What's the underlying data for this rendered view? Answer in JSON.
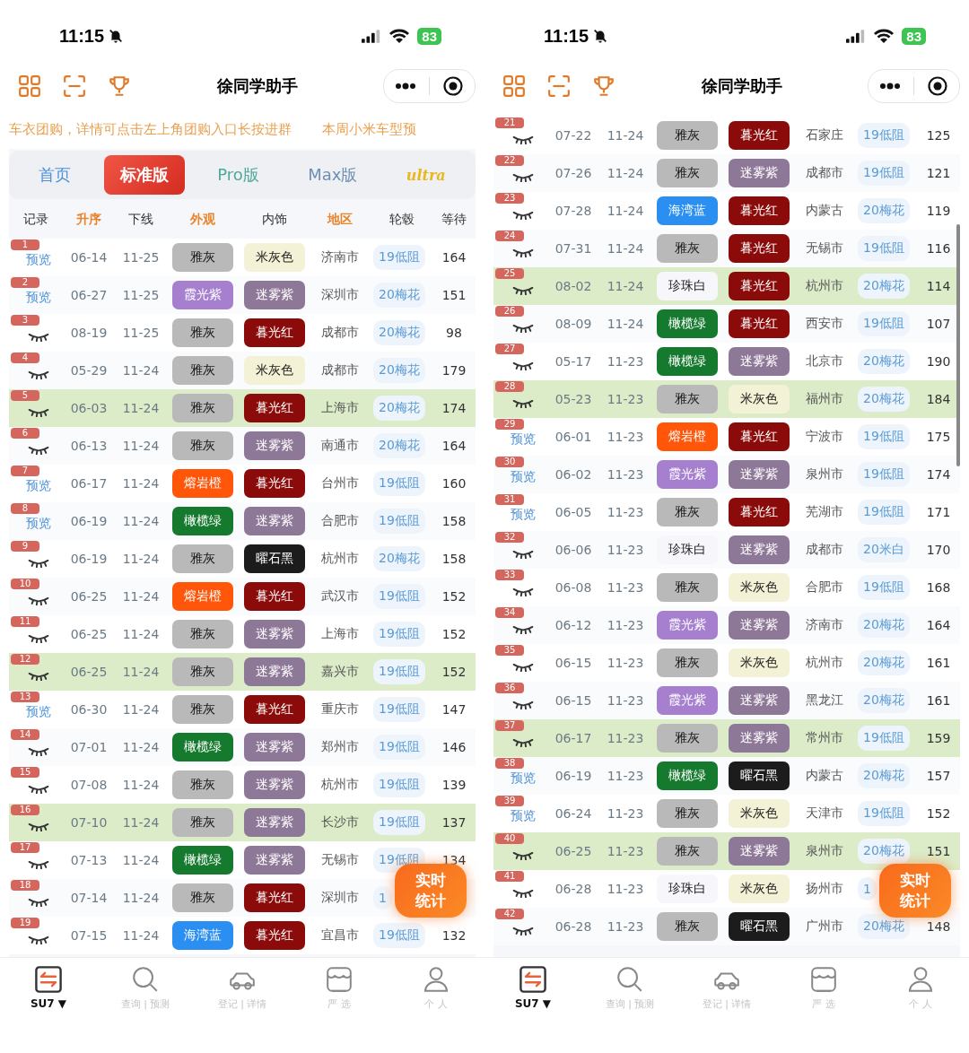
{
  "panels": [
    {
      "status_bar": {
        "time": "11:15",
        "battery": "83"
      },
      "header": {
        "title": "徐同学助手"
      },
      "marquee": [
        "车衣团购，详情可点击左上角团购入口长按进群",
        "本周小米车型预"
      ],
      "tabs": [
        {
          "label": "首页",
          "selected": false,
          "kind": "text",
          "color": "#4a90d9"
        },
        {
          "label": "标准版",
          "selected": true,
          "kind": "text"
        },
        {
          "label": "Pro版",
          "selected": false,
          "kind": "text",
          "color": "#4fa89a"
        },
        {
          "label": "Max版",
          "selected": false,
          "kind": "text",
          "color": "#6f8fb5"
        },
        {
          "label": "ultra",
          "selected": false,
          "kind": "logo",
          "color": "#e8b820"
        }
      ],
      "table": {
        "columns": [
          {
            "label": "记录",
            "highlighted": false
          },
          {
            "label": "升序",
            "highlighted": true
          },
          {
            "label": "下线",
            "highlighted": false
          },
          {
            "label": "外观",
            "highlighted": true
          },
          {
            "label": "内饰",
            "highlighted": false
          },
          {
            "label": "地区",
            "highlighted": true
          },
          {
            "label": "轮毂",
            "highlighted": false
          },
          {
            "label": "等待",
            "highlighted": false
          }
        ],
        "rows": [
          {
            "no": "1",
            "record": {
              "kind": "link",
              "text": "预览"
            },
            "order": "06-14",
            "offline": "11-25",
            "exterior": {
              "text": "雅灰",
              "color": "#b9b9b9"
            },
            "interior": {
              "text": "米灰色",
              "color": "#f3f1d6"
            },
            "region": "济南市",
            "wheel": "19低阻",
            "wait": "164",
            "selected": false
          },
          {
            "no": "2",
            "record": {
              "kind": "link",
              "text": "预览"
            },
            "order": "06-27",
            "offline": "11-25",
            "exterior": {
              "text": "霞光紫",
              "color": "#a67fcf"
            },
            "interior": {
              "text": "迷雾紫",
              "color": "#8e7898"
            },
            "region": "深圳市",
            "wheel": "20梅花",
            "wait": "151",
            "selected": false
          },
          {
            "no": "3",
            "record": {
              "kind": "eye"
            },
            "order": "08-19",
            "offline": "11-25",
            "exterior": {
              "text": "雅灰",
              "color": "#b9b9b9"
            },
            "interior": {
              "text": "暮光红",
              "color": "#8b0a0a"
            },
            "region": "成都市",
            "wheel": "20梅花",
            "wait": "98",
            "selected": false
          },
          {
            "no": "4",
            "record": {
              "kind": "eye"
            },
            "order": "05-29",
            "offline": "11-24",
            "exterior": {
              "text": "雅灰",
              "color": "#b9b9b9"
            },
            "interior": {
              "text": "米灰色",
              "color": "#f3f1d6"
            },
            "region": "成都市",
            "wheel": "20梅花",
            "wait": "179",
            "selected": false
          },
          {
            "no": "5",
            "record": {
              "kind": "eye"
            },
            "order": "06-03",
            "offline": "11-24",
            "exterior": {
              "text": "雅灰",
              "color": "#b9b9b9"
            },
            "interior": {
              "text": "暮光红",
              "color": "#8b0a0a"
            },
            "region": "上海市",
            "wheel": "20梅花",
            "wait": "174",
            "selected": true
          },
          {
            "no": "6",
            "record": {
              "kind": "eye"
            },
            "order": "06-13",
            "offline": "11-24",
            "exterior": {
              "text": "雅灰",
              "color": "#b9b9b9"
            },
            "interior": {
              "text": "迷雾紫",
              "color": "#8e7898"
            },
            "region": "南通市",
            "wheel": "20梅花",
            "wait": "164",
            "selected": false
          },
          {
            "no": "7",
            "record": {
              "kind": "link",
              "text": "预览"
            },
            "order": "06-17",
            "offline": "11-24",
            "exterior": {
              "text": "熔岩橙",
              "color": "#ff560a"
            },
            "interior": {
              "text": "暮光红",
              "color": "#8b0a0a"
            },
            "region": "台州市",
            "wheel": "19低阻",
            "wait": "160",
            "selected": false
          },
          {
            "no": "8",
            "record": {
              "kind": "link",
              "text": "预览"
            },
            "order": "06-19",
            "offline": "11-24",
            "exterior": {
              "text": "橄榄绿",
              "color": "#157a2e"
            },
            "interior": {
              "text": "迷雾紫",
              "color": "#8e7898"
            },
            "region": "合肥市",
            "wheel": "19低阻",
            "wait": "158",
            "selected": false
          },
          {
            "no": "9",
            "record": {
              "kind": "eye"
            },
            "order": "06-19",
            "offline": "11-24",
            "exterior": {
              "text": "雅灰",
              "color": "#b9b9b9"
            },
            "interior": {
              "text": "曜石黑",
              "color": "#1c1c1c"
            },
            "region": "杭州市",
            "wheel": "20梅花",
            "wait": "158",
            "selected": false
          },
          {
            "no": "10",
            "record": {
              "kind": "eye"
            },
            "order": "06-25",
            "offline": "11-24",
            "exterior": {
              "text": "熔岩橙",
              "color": "#ff560a"
            },
            "interior": {
              "text": "暮光红",
              "color": "#8b0a0a"
            },
            "region": "武汉市",
            "wheel": "19低阻",
            "wait": "152",
            "selected": false
          },
          {
            "no": "11",
            "record": {
              "kind": "eye"
            },
            "order": "06-25",
            "offline": "11-24",
            "exterior": {
              "text": "雅灰",
              "color": "#b9b9b9"
            },
            "interior": {
              "text": "迷雾紫",
              "color": "#8e7898"
            },
            "region": "上海市",
            "wheel": "19低阻",
            "wait": "152",
            "selected": false
          },
          {
            "no": "12",
            "record": {
              "kind": "eye"
            },
            "order": "06-25",
            "offline": "11-24",
            "exterior": {
              "text": "雅灰",
              "color": "#b9b9b9"
            },
            "interior": {
              "text": "迷雾紫",
              "color": "#8e7898"
            },
            "region": "嘉兴市",
            "wheel": "19低阻",
            "wait": "152",
            "selected": true
          },
          {
            "no": "13",
            "record": {
              "kind": "link",
              "text": "预览"
            },
            "order": "06-30",
            "offline": "11-24",
            "exterior": {
              "text": "雅灰",
              "color": "#b9b9b9"
            },
            "interior": {
              "text": "暮光红",
              "color": "#8b0a0a"
            },
            "region": "重庆市",
            "wheel": "19低阻",
            "wait": "147",
            "selected": false
          },
          {
            "no": "14",
            "record": {
              "kind": "eye"
            },
            "order": "07-01",
            "offline": "11-24",
            "exterior": {
              "text": "橄榄绿",
              "color": "#157a2e"
            },
            "interior": {
              "text": "迷雾紫",
              "color": "#8e7898"
            },
            "region": "郑州市",
            "wheel": "19低阻",
            "wait": "146",
            "selected": false
          },
          {
            "no": "15",
            "record": {
              "kind": "eye"
            },
            "order": "07-08",
            "offline": "11-24",
            "exterior": {
              "text": "雅灰",
              "color": "#b9b9b9"
            },
            "interior": {
              "text": "迷雾紫",
              "color": "#8e7898"
            },
            "region": "杭州市",
            "wheel": "19低阻",
            "wait": "139",
            "selected": false
          },
          {
            "no": "16",
            "record": {
              "kind": "eye"
            },
            "order": "07-10",
            "offline": "11-24",
            "exterior": {
              "text": "雅灰",
              "color": "#b9b9b9"
            },
            "interior": {
              "text": "迷雾紫",
              "color": "#8e7898"
            },
            "region": "长沙市",
            "wheel": "19低阻",
            "wait": "137",
            "selected": true
          },
          {
            "no": "17",
            "record": {
              "kind": "eye"
            },
            "order": "07-13",
            "offline": "11-24",
            "exterior": {
              "text": "橄榄绿",
              "color": "#157a2e"
            },
            "interior": {
              "text": "迷雾紫",
              "color": "#8e7898"
            },
            "region": "无锡市",
            "wheel": "19低阻",
            "wait": "134",
            "selected": false
          },
          {
            "no": "18",
            "record": {
              "kind": "eye"
            },
            "order": "07-14",
            "offline": "11-24",
            "exterior": {
              "text": "雅灰",
              "color": "#b9b9b9"
            },
            "interior": {
              "text": "暮光红",
              "color": "#8b0a0a"
            },
            "region": "深圳市",
            "wheel": "1",
            "selected": false
          },
          {
            "no": "19",
            "record": {
              "kind": "eye"
            },
            "order": "07-15",
            "offline": "11-24",
            "exterior": {
              "text": "海湾蓝",
              "color": "#2a8ff0"
            },
            "interior": {
              "text": "暮光红",
              "color": "#8b0a0a"
            },
            "region": "宜昌市",
            "wheel": "19低阻",
            "wait": "132",
            "selected": false
          }
        ]
      },
      "float_button": {
        "label": "实时统计"
      },
      "nav": [
        {
          "label": "SU7 ▼",
          "kind": "switch",
          "selected": true
        },
        {
          "label": "查询 | 预测",
          "kind": "search",
          "selected": false
        },
        {
          "label": "登记 | 详情",
          "kind": "car",
          "selected": false
        },
        {
          "label": "严 选",
          "kind": "store",
          "selected": false
        },
        {
          "label": "个 人",
          "kind": "person",
          "selected": false
        }
      ]
    },
    {
      "status_bar": {
        "time": "11:15",
        "battery": "83"
      },
      "header": {
        "title": "徐同学助手"
      },
      "table": {
        "rows": [
          {
            "no": "21",
            "record": {
              "kind": "eye"
            },
            "order": "07-22",
            "offline": "11-24",
            "exterior": {
              "text": "雅灰",
              "color": "#b9b9b9"
            },
            "interior": {
              "text": "暮光红",
              "color": "#8b0a0a"
            },
            "region": "石家庄",
            "wheel": "19低阻",
            "wait": "125",
            "selected": false
          },
          {
            "no": "22",
            "record": {
              "kind": "eye"
            },
            "order": "07-26",
            "offline": "11-24",
            "exterior": {
              "text": "雅灰",
              "color": "#b9b9b9"
            },
            "interior": {
              "text": "迷雾紫",
              "color": "#8e7898"
            },
            "region": "成都市",
            "wheel": "19低阻",
            "wait": "121",
            "selected": false
          },
          {
            "no": "23",
            "record": {
              "kind": "eye"
            },
            "order": "07-28",
            "offline": "11-24",
            "exterior": {
              "text": "海湾蓝",
              "color": "#2a8ff0"
            },
            "interior": {
              "text": "暮光红",
              "color": "#8b0a0a"
            },
            "region": "内蒙古",
            "wheel": "20梅花",
            "wait": "119",
            "selected": false
          },
          {
            "no": "24",
            "record": {
              "kind": "eye"
            },
            "order": "07-31",
            "offline": "11-24",
            "exterior": {
              "text": "雅灰",
              "color": "#b9b9b9"
            },
            "interior": {
              "text": "暮光红",
              "color": "#8b0a0a"
            },
            "region": "无锡市",
            "wheel": "19低阻",
            "wait": "116",
            "selected": false
          },
          {
            "no": "25",
            "record": {
              "kind": "eye"
            },
            "order": "08-02",
            "offline": "11-24",
            "exterior": {
              "text": "珍珠白",
              "color": "#f6f6fb"
            },
            "interior": {
              "text": "暮光红",
              "color": "#8b0a0a"
            },
            "region": "杭州市",
            "wheel": "20梅花",
            "wait": "114",
            "selected": true
          },
          {
            "no": "26",
            "record": {
              "kind": "eye"
            },
            "order": "08-09",
            "offline": "11-24",
            "exterior": {
              "text": "橄榄绿",
              "color": "#157a2e"
            },
            "interior": {
              "text": "暮光红",
              "color": "#8b0a0a"
            },
            "region": "西安市",
            "wheel": "19低阻",
            "wait": "107",
            "selected": false
          },
          {
            "no": "27",
            "record": {
              "kind": "eye"
            },
            "order": "05-17",
            "offline": "11-23",
            "exterior": {
              "text": "橄榄绿",
              "color": "#157a2e"
            },
            "interior": {
              "text": "迷雾紫",
              "color": "#8e7898"
            },
            "region": "北京市",
            "wheel": "20梅花",
            "wait": "190",
            "selected": false
          },
          {
            "no": "28",
            "record": {
              "kind": "eye"
            },
            "order": "05-23",
            "offline": "11-23",
            "exterior": {
              "text": "雅灰",
              "color": "#b9b9b9"
            },
            "interior": {
              "text": "米灰色",
              "color": "#f3f1d6"
            },
            "region": "福州市",
            "wheel": "20梅花",
            "wait": "184",
            "selected": true
          },
          {
            "no": "29",
            "record": {
              "kind": "link",
              "text": "预览"
            },
            "order": "06-01",
            "offline": "11-23",
            "exterior": {
              "text": "熔岩橙",
              "color": "#ff560a"
            },
            "interior": {
              "text": "暮光红",
              "color": "#8b0a0a"
            },
            "region": "宁波市",
            "wheel": "19低阻",
            "wait": "175",
            "selected": false
          },
          {
            "no": "30",
            "record": {
              "kind": "link",
              "text": "预览"
            },
            "order": "06-02",
            "offline": "11-23",
            "exterior": {
              "text": "霞光紫",
              "color": "#a67fcf"
            },
            "interior": {
              "text": "迷雾紫",
              "color": "#8e7898"
            },
            "region": "泉州市",
            "wheel": "19低阻",
            "wait": "174",
            "selected": false
          },
          {
            "no": "31",
            "record": {
              "kind": "link",
              "text": "预览"
            },
            "order": "06-05",
            "offline": "11-23",
            "exterior": {
              "text": "雅灰",
              "color": "#b9b9b9"
            },
            "interior": {
              "text": "暮光红",
              "color": "#8b0a0a"
            },
            "region": "芜湖市",
            "wheel": "19低阻",
            "wait": "171",
            "selected": false
          },
          {
            "no": "32",
            "record": {
              "kind": "eye"
            },
            "order": "06-06",
            "offline": "11-23",
            "exterior": {
              "text": "珍珠白",
              "color": "#f6f6fb"
            },
            "interior": {
              "text": "迷雾紫",
              "color": "#8e7898"
            },
            "region": "成都市",
            "wheel": "20米白",
            "wait": "170",
            "selected": false
          },
          {
            "no": "33",
            "record": {
              "kind": "eye"
            },
            "order": "06-08",
            "offline": "11-23",
            "exterior": {
              "text": "雅灰",
              "color": "#b9b9b9"
            },
            "interior": {
              "text": "米灰色",
              "color": "#f3f1d6"
            },
            "region": "合肥市",
            "wheel": "19低阻",
            "wait": "168",
            "selected": false
          },
          {
            "no": "34",
            "record": {
              "kind": "eye"
            },
            "order": "06-12",
            "offline": "11-23",
            "exterior": {
              "text": "霞光紫",
              "color": "#a67fcf"
            },
            "interior": {
              "text": "迷雾紫",
              "color": "#8e7898"
            },
            "region": "济南市",
            "wheel": "20梅花",
            "wait": "164",
            "selected": false
          },
          {
            "no": "35",
            "record": {
              "kind": "eye"
            },
            "order": "06-15",
            "offline": "11-23",
            "exterior": {
              "text": "雅灰",
              "color": "#b9b9b9"
            },
            "interior": {
              "text": "米灰色",
              "color": "#f3f1d6"
            },
            "region": "杭州市",
            "wheel": "20梅花",
            "wait": "161",
            "selected": false
          },
          {
            "no": "36",
            "record": {
              "kind": "eye"
            },
            "order": "06-15",
            "offline": "11-23",
            "exterior": {
              "text": "霞光紫",
              "color": "#a67fcf"
            },
            "interior": {
              "text": "迷雾紫",
              "color": "#8e7898"
            },
            "region": "黑龙江",
            "wheel": "20梅花",
            "wait": "161",
            "selected": false
          },
          {
            "no": "37",
            "record": {
              "kind": "eye"
            },
            "order": "06-17",
            "offline": "11-23",
            "exterior": {
              "text": "雅灰",
              "color": "#b9b9b9"
            },
            "interior": {
              "text": "迷雾紫",
              "color": "#8e7898"
            },
            "region": "常州市",
            "wheel": "19低阻",
            "wait": "159",
            "selected": true
          },
          {
            "no": "38",
            "record": {
              "kind": "link",
              "text": "预览"
            },
            "order": "06-19",
            "offline": "11-23",
            "exterior": {
              "text": "橄榄绿",
              "color": "#157a2e"
            },
            "interior": {
              "text": "曜石黑",
              "color": "#1c1c1c"
            },
            "region": "内蒙古",
            "wheel": "20梅花",
            "wait": "157",
            "selected": false
          },
          {
            "no": "39",
            "record": {
              "kind": "link",
              "text": "预览"
            },
            "order": "06-24",
            "offline": "11-23",
            "exterior": {
              "text": "雅灰",
              "color": "#b9b9b9"
            },
            "interior": {
              "text": "米灰色",
              "color": "#f3f1d6"
            },
            "region": "天津市",
            "wheel": "19低阻",
            "wait": "152",
            "selected": false
          },
          {
            "no": "40",
            "record": {
              "kind": "eye"
            },
            "order": "06-25",
            "offline": "11-23",
            "exterior": {
              "text": "雅灰",
              "color": "#b9b9b9"
            },
            "interior": {
              "text": "迷雾紫",
              "color": "#8e7898"
            },
            "region": "泉州市",
            "wheel": "20梅花",
            "wait": "151",
            "selected": true
          },
          {
            "no": "41",
            "record": {
              "kind": "eye"
            },
            "order": "06-28",
            "offline": "11-23",
            "exterior": {
              "text": "珍珠白",
              "color": "#f6f6fb"
            },
            "interior": {
              "text": "米灰色",
              "color": "#f3f1d6"
            },
            "region": "扬州市",
            "wheel": "1",
            "selected": false
          },
          {
            "no": "42",
            "record": {
              "kind": "eye"
            },
            "order": "06-28",
            "offline": "11-23",
            "exterior": {
              "text": "雅灰",
              "color": "#b9b9b9"
            },
            "interior": {
              "text": "曜石黑",
              "color": "#1c1c1c"
            },
            "region": "广州市",
            "wheel": "20梅花",
            "wait": "148",
            "selected": false
          }
        ]
      },
      "float_button": {
        "label": "实时统计"
      },
      "nav": [
        {
          "label": "SU7 ▼",
          "kind": "switch",
          "selected": true
        },
        {
          "label": "查询 | 预测",
          "kind": "search",
          "selected": false
        },
        {
          "label": "登记 | 详情",
          "kind": "car",
          "selected": false
        },
        {
          "label": "严 选",
          "kind": "store",
          "selected": false
        },
        {
          "label": "个 人",
          "kind": "person",
          "selected": false
        }
      ]
    }
  ]
}
